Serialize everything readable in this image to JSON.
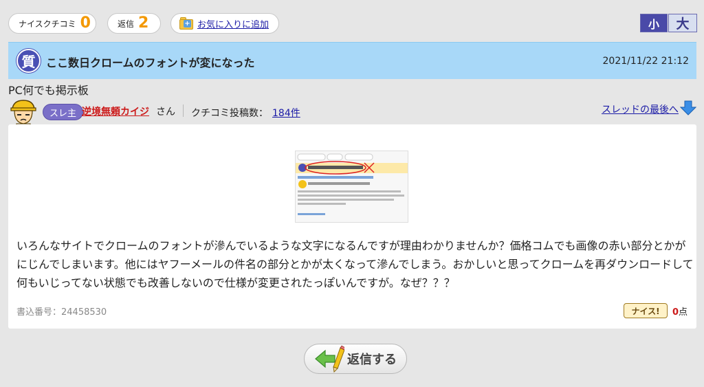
{
  "top": {
    "nice_label": "ナイスクチコミ",
    "nice_count": "0",
    "reply_label": "返信",
    "reply_count": "2",
    "favorite_label": "お気に入りに追加",
    "size_small": "小",
    "size_large": "大"
  },
  "thread": {
    "q_mark": "質",
    "title": "ここ数日クロームのフォントが変になった",
    "date": "2021/11/22 21:12",
    "board": "PC何でも掲示板"
  },
  "author": {
    "badge": "スレ主",
    "name": "逆境無頼カイジ",
    "honorific": "さん",
    "post_count_label": "クチコミ投稿数：",
    "post_count": "184件",
    "to_last": "スレッドの最後へ"
  },
  "post": {
    "body": "いろんなサイトでクロームのフォントが滲んでいるような文字になるんですが理由わかりませんか？価格コムでも画像の赤い部分とかがにじんでしまいます。他にはヤフーメールの件名の部分とかが太くなって滲んでしまう。おかしいと思ってクロームを再ダウンロードして何もいじってない状態でも改善しないので仕様が変更されたっぽいんですが。なぜ？？？",
    "number": "書込番号：24458530",
    "nice_button": "ナイス!",
    "nice_points": "0",
    "points_unit": "点"
  },
  "reply_button": "返信する",
  "colors": {
    "accent_orange": "#f39800",
    "title_bar": "#a8d8f8",
    "link": "#1a1aa6",
    "author_red": "#cc1a1a"
  }
}
